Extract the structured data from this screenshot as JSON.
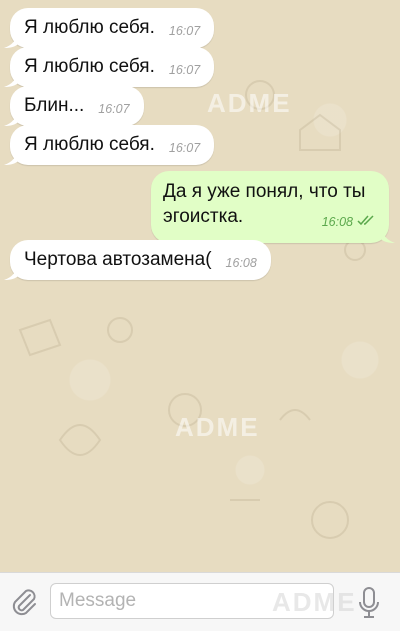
{
  "messages": [
    {
      "text": "Я люблю себя.",
      "time": "16:07",
      "dir": "in"
    },
    {
      "text": "Я люблю себя.",
      "time": "16:07",
      "dir": "in"
    },
    {
      "text": "Блин...",
      "time": "16:07",
      "dir": "in"
    },
    {
      "text": "Я люблю себя.",
      "time": "16:07",
      "dir": "in"
    },
    {
      "text": "Да я уже понял, что ты эгоистка.",
      "time": "16:08",
      "dir": "out",
      "status": "read"
    },
    {
      "text": "Чертова автозамена(",
      "time": "16:08",
      "dir": "in"
    }
  ],
  "composer": {
    "placeholder": "Message",
    "attach_icon": "paperclip-icon",
    "mic_icon": "microphone-icon"
  },
  "watermark": "ADME",
  "colors": {
    "chat_background": "#e7dcc1",
    "incoming_bubble": "#ffffff",
    "outgoing_bubble": "#e1fec6",
    "outgoing_time": "#5ba84c",
    "incoming_time": "#a0a0a0",
    "composer_bar": "#f7f7f7"
  }
}
